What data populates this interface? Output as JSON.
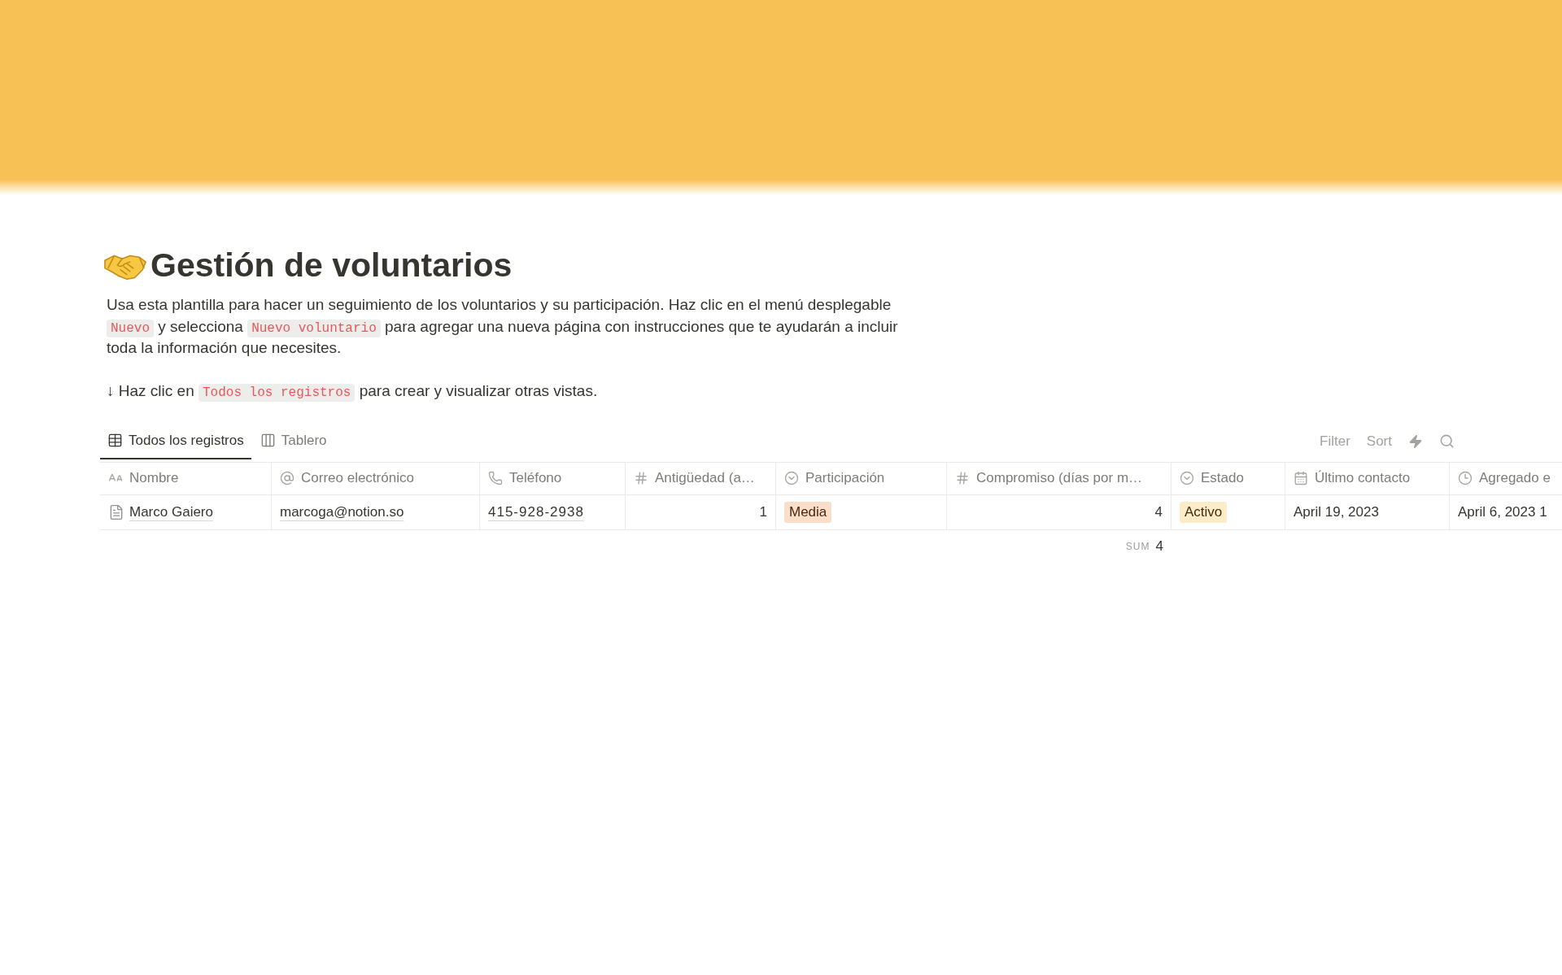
{
  "page": {
    "title": "Gestión de voluntarios",
    "description": [
      [
        {
          "kind": "text",
          "text": "Usa esta plantilla para hacer un seguimiento de los voluntarios y su participación. Haz clic en el menú desplegable "
        },
        {
          "kind": "code",
          "text": "Nuevo"
        },
        {
          "kind": "text",
          "text": " y selecciona "
        },
        {
          "kind": "code",
          "text": "Nuevo voluntario"
        },
        {
          "kind": "text",
          "text": " para agregar una nueva página con instrucciones que te ayudarán a incluir toda la información que necesites."
        }
      ],
      [
        {
          "kind": "text",
          "text": "↓ Haz clic en "
        },
        {
          "kind": "code",
          "text": "Todos los registros"
        },
        {
          "kind": "text",
          "text": " para crear y visualizar otras vistas."
        }
      ]
    ]
  },
  "views": {
    "tabs": [
      {
        "kind": "table",
        "label": "Todos los registros",
        "selected": true
      },
      {
        "kind": "board",
        "label": "Tablero",
        "selected": false
      }
    ],
    "toolbar": [
      "Filter",
      "Sort"
    ]
  },
  "table": {
    "columns": [
      {
        "kind": "title",
        "label": "Nombre"
      },
      {
        "kind": "email",
        "label": "Correo electrónico"
      },
      {
        "kind": "phone",
        "label": "Teléfono"
      },
      {
        "kind": "number",
        "label": "Antigüedad (a…"
      },
      {
        "kind": "select",
        "label": "Participación"
      },
      {
        "kind": "number",
        "label": "Compromiso (días por m…",
        "calculation": {
          "label": "SUM",
          "value": "4"
        }
      },
      {
        "kind": "select",
        "label": "Estado"
      },
      {
        "kind": "date",
        "label": "Último contacto"
      },
      {
        "kind": "created",
        "label": "Agregado e"
      }
    ],
    "rows": [
      {
        "cells": [
          {
            "text": "Marco Gaiero"
          },
          {
            "text": "marcoga@notion.so"
          },
          {
            "text": "415-928-2938"
          },
          {
            "text": "1"
          },
          {
            "text": "Media",
            "color": "#fadec9"
          },
          {
            "text": "4"
          },
          {
            "text": "Activo",
            "color": "#fdecc8"
          },
          {
            "text": "April 19, 2023"
          },
          {
            "text": "April 6, 2023 1"
          }
        ]
      }
    ]
  }
}
